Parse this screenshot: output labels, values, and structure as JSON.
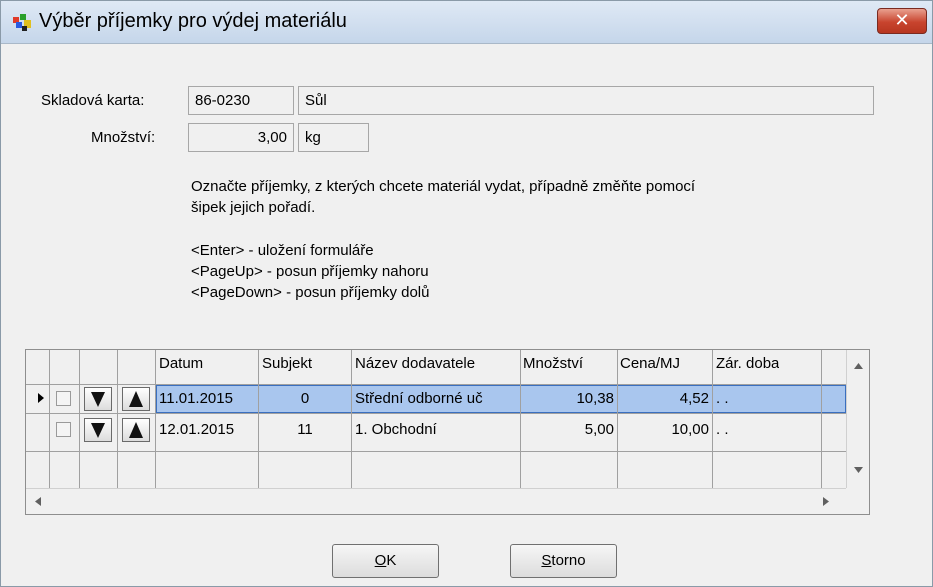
{
  "window": {
    "title": "Výběr příjemky pro výdej materiálu",
    "close_glyph": "✕"
  },
  "card": {
    "label": "Skladová karta:",
    "code": "86-0230",
    "name": "Sůl"
  },
  "quantity": {
    "label": "Množství:",
    "value": "3,00",
    "unit": "kg"
  },
  "instructions": {
    "line1": "Označte příjemky, z kterých chcete materiál vydat, případně změňte pomocí",
    "line2": "šipek jejich pořadí.",
    "key1": "<Enter> - uložení formuláře",
    "key2": "<PageUp> - posun příjemky nahoru",
    "key3": "<PageDown> - posun příjemky dolů"
  },
  "table": {
    "headers": [
      "Datum",
      "Subjekt",
      "Název dodavatele",
      "Množství",
      "Cena/MJ",
      "Zár. doba"
    ],
    "rows": [
      {
        "datum": "11.01.2015",
        "subjekt": "0",
        "dodavatel": "Střední odborné uč",
        "mnozstvi": "10,38",
        "cena": "4,52",
        "zaruka": ". .",
        "selected": true
      },
      {
        "datum": "12.01.2015",
        "subjekt": "11",
        "dodavatel": "1. Obchodní",
        "mnozstvi": "5,00",
        "cena": "10,00",
        "zaruka": ". .",
        "selected": false
      }
    ]
  },
  "buttons": {
    "ok_mnemonic": "O",
    "ok_rest": "K",
    "storno_mnemonic": "S",
    "storno_rest": "torno"
  },
  "colors": {
    "selection": "#a9c6ee",
    "titlebar": "#dfe9f5",
    "close": "#c8442e"
  }
}
